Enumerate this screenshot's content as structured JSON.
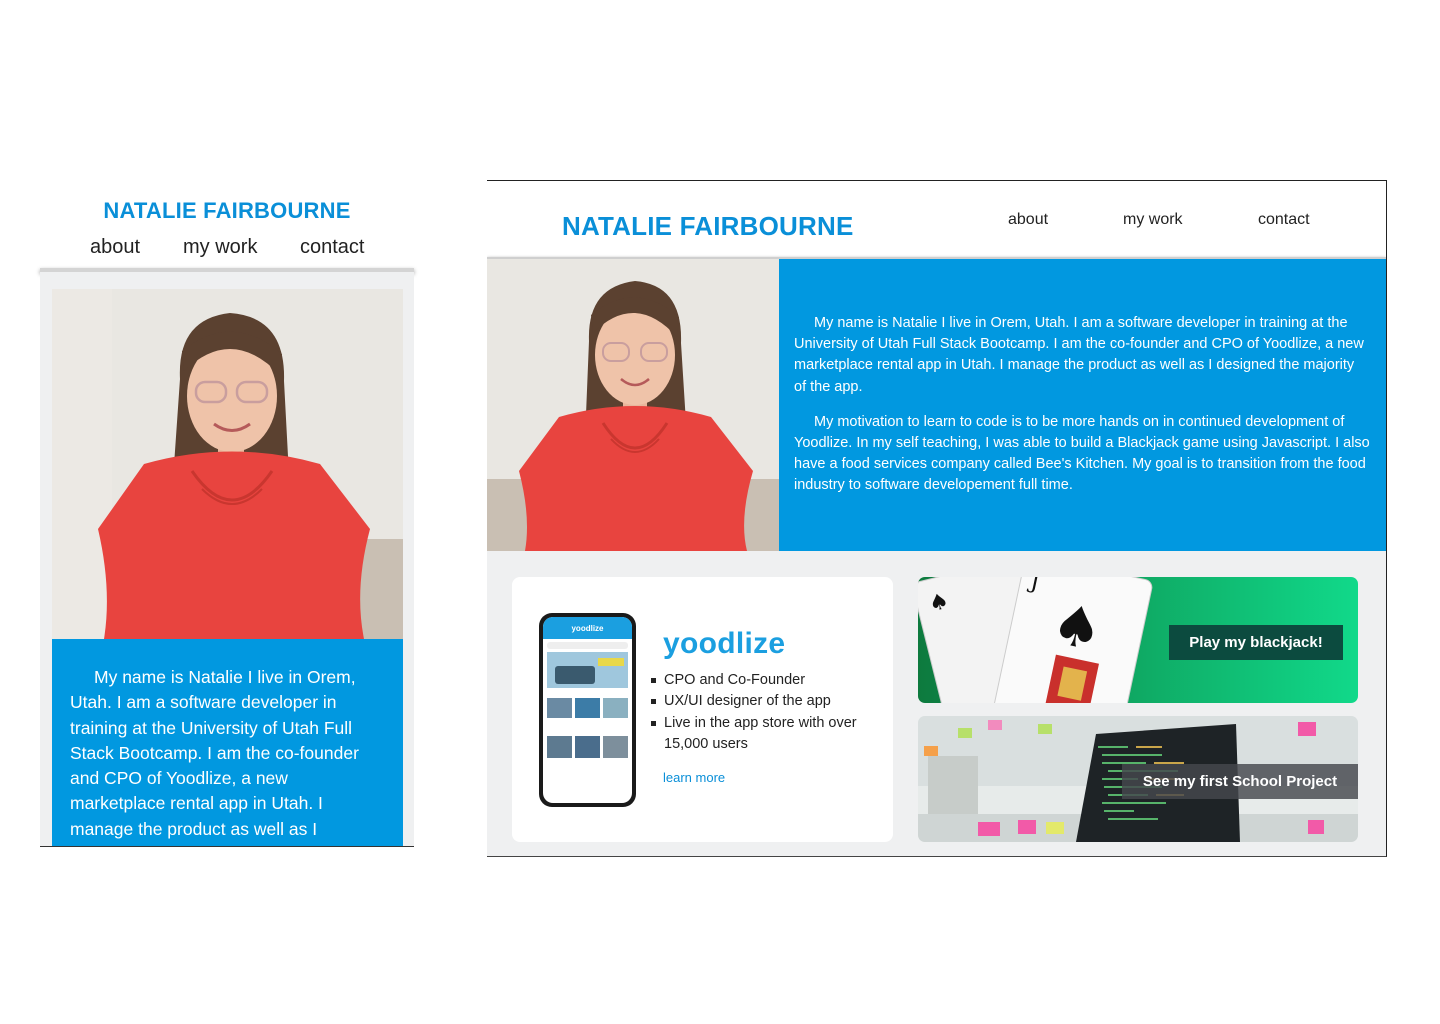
{
  "owner_name": "NATALIE FAIRBOURNE",
  "nav": {
    "about": "about",
    "work": "my work",
    "contact": "contact"
  },
  "mobile": {
    "about_excerpt": "My name is Natalie I live in Orem, Utah. I am a software developer in training at the University of Utah Full Stack Bootcamp. I am the co-founder and CPO of Yoodlize, a new marketplace rental app in Utah. I manage the product as well as I"
  },
  "about": {
    "paragraph1": "My name is Natalie I live in Orem, Utah. I am a software developer in training at the University of Utah Full Stack Bootcamp. I am the co-founder and CPO of Yoodlize, a new marketplace rental app in Utah. I manage the product as well as I designed the majority of the app.",
    "paragraph2": "My motivation to learn to code is to be more hands on in continued development of Yoodlize. In my self teaching, I was able to build a Blackjack game using Javascript. I also have a food services company called Bee's Kitchen. My goal is to transition from the food industry to software developement full time."
  },
  "yoodlize_card": {
    "logo_text": "yoodlize",
    "bullets": [
      "CPO and Co-Founder",
      "UX/UI designer of the app",
      "Live in the app store with over 15,000 users"
    ],
    "learn_more": "learn more",
    "phone_app_name": "yoodlize"
  },
  "projects": {
    "blackjack_label": "Play my blackjack!",
    "school_label": "See my first School Project"
  },
  "colors": {
    "accent": "#0198e0",
    "name": "#0a8fd8",
    "blackjack_button": "#0c4b3f"
  },
  "icons": {
    "portrait": "portrait-photo",
    "cards": "playing-cards-image",
    "laptop": "laptop-code-image"
  }
}
